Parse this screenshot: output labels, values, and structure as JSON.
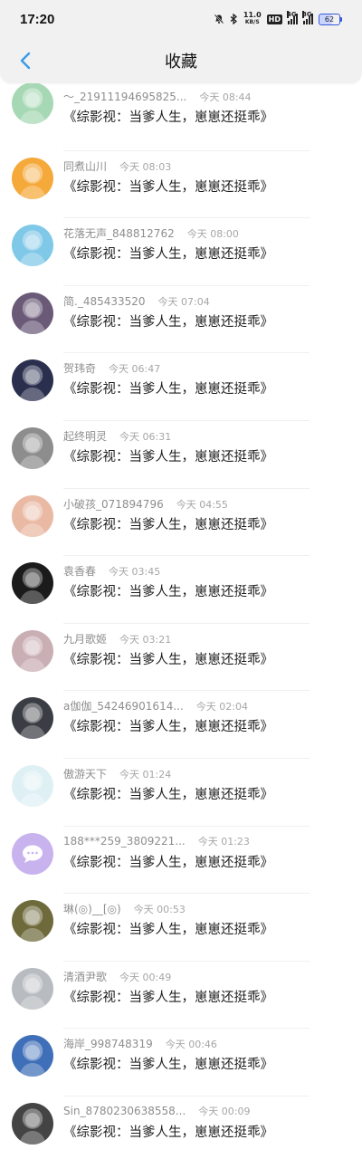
{
  "status_bar": {
    "time": "17:20",
    "net_speed_value": "11.0",
    "net_speed_unit": "KB/S",
    "hd_label": "HD",
    "signal1_tag": "4G",
    "signal2_tag": "3G",
    "battery": "62"
  },
  "header": {
    "title": "收藏"
  },
  "items": [
    {
      "name": "～_219111946958​25...",
      "time": "今天 08:44",
      "message": "《综影视：当爹人生，崽崽还挺乖》",
      "avatar_color": "#a7d8b5",
      "avatar_icon": "anime-girl-avatar"
    },
    {
      "name": "同煮山川",
      "time": "今天 08:03",
      "message": "《综影视：当爹人生，崽崽还挺乖》",
      "avatar_color": "#f5a93a",
      "avatar_icon": "anime-boy-avatar"
    },
    {
      "name": "花落无声_848812762",
      "time": "今天 08:00",
      "message": "《综影视：当爹人生，崽崽还挺乖》",
      "avatar_color": "#7fc8e8",
      "avatar_icon": "sky-avatar"
    },
    {
      "name": "简._485433520",
      "time": "今天 07:04",
      "message": "《综影视：当爹人生，崽崽还挺乖》",
      "avatar_color": "#6a5a78",
      "avatar_icon": "woman-avatar"
    },
    {
      "name": "贺玮奇",
      "time": "今天 06:47",
      "message": "《综影视：当爹人生，崽崽还挺乖》",
      "avatar_color": "#2a2f4e",
      "avatar_icon": "night-sky-avatar"
    },
    {
      "name": "起终明灵",
      "time": "今天 06:31",
      "message": "《综影视：当爹人生，崽崽还挺乖》",
      "avatar_color": "#8d8d8d",
      "avatar_icon": "gray-figure-avatar"
    },
    {
      "name": "小破孩_071894796",
      "time": "今天 04:55",
      "message": "《综影视：当爹人生，崽崽还挺乖》",
      "avatar_color": "#e9b9a3",
      "avatar_icon": "girl-drawing-avatar"
    },
    {
      "name": "袁香春",
      "time": "今天 03:45",
      "message": "《综影视：当爹人生，崽崽还挺乖》",
      "avatar_color": "#1b1b1b",
      "avatar_icon": "dark-figure-avatar"
    },
    {
      "name": "九月歌姬",
      "time": "今天 03:21",
      "message": "《综影视：当爹人生，崽崽还挺乖》",
      "avatar_color": "#c9aeb4",
      "avatar_icon": "face-avatar"
    },
    {
      "name": "a伽伽_54246901614...",
      "time": "今天 02:04",
      "message": "《综影视：当爹人生，崽崽还挺乖》",
      "avatar_color": "#3b3d44",
      "avatar_icon": "dark-anime-avatar"
    },
    {
      "name": "傲游天下",
      "time": "今天 01:24",
      "message": "《综影视：当爹人生，崽崽还挺乖》",
      "avatar_color": "#dff0f5",
      "avatar_icon": "light-figure-avatar"
    },
    {
      "name": "188***259_3809221...",
      "time": "今天 01:23",
      "message": "《综影视：当爹人生，崽崽还挺乖》",
      "avatar_color": "#c9b3ee",
      "avatar_icon": "chat-bubble-icon"
    },
    {
      "name": "琳(◎)__[◎)",
      "time": "今天 00:53",
      "message": "《综影视：当爹人生，崽崽还挺乖》",
      "avatar_color": "#6e6a3c",
      "avatar_icon": "girl-photo-avatar"
    },
    {
      "name": "清酒尹歌",
      "time": "今天 00:49",
      "message": "《综影视：当爹人生，崽崽还挺乖》",
      "avatar_color": "#b8bcc0",
      "avatar_icon": "sketch-avatar"
    },
    {
      "name": "海岸_998748319",
      "time": "今天 00:46",
      "message": "《综影视：当爹人生，崽崽还挺乖》",
      "avatar_color": "#3f6fb8",
      "avatar_icon": "cartoon-face-avatar"
    },
    {
      "name": "Sin_8780230638558...",
      "time": "今天 00:09",
      "message": "《综影视：当爹人生，崽崽还挺乖》",
      "avatar_color": "#444444",
      "avatar_icon": "bw-portrait-avatar"
    }
  ]
}
